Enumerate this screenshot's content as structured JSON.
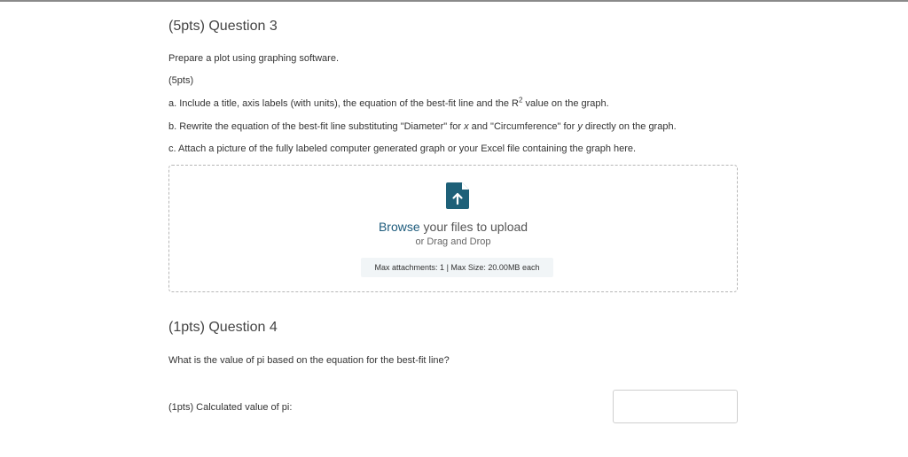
{
  "question3": {
    "title": "(5pts) Question 3",
    "intro": "Prepare a plot using graphing software.",
    "points": "(5pts)",
    "item_a_before": "a. Include a title, axis labels (with units), the equation of the best-fit line and the R",
    "item_a_sup": "2",
    "item_a_after": " value on the graph.",
    "item_b_1": "b. Rewrite the equation of the best-fit line substituting \"Diameter\" for ",
    "item_b_x": "x",
    "item_b_2": " and \"Circumference\" for ",
    "item_b_y": "y",
    "item_b_3": " directly on the graph.",
    "item_c": "c. Attach a picture of the fully labeled computer generated graph or your Excel file containing the graph here."
  },
  "upload": {
    "browse_link": "Browse",
    "browse_rest": " your files to upload",
    "drag_text": "or Drag and Drop",
    "limits": "Max attachments: 1 | Max Size: 20.00MB each",
    "icon": "file-upload-icon",
    "icon_color": "#1e6078"
  },
  "question4": {
    "title": "(1pts) Question 4",
    "prompt": "What is the value of pi based on the equation for the best-fit line?",
    "answer_label": "(1pts)  Calculated value of pi:",
    "answer_value": ""
  }
}
